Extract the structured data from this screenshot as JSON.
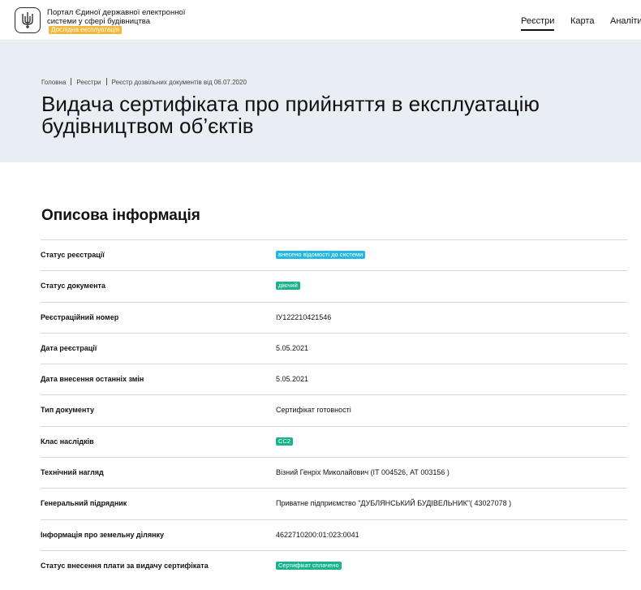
{
  "header": {
    "logo_icon": "trident-coat-of-arms-icon",
    "portal_title": "Портал Єдиної державної електронної системи у сфері будівництва",
    "beta_badge": "Дослідна експлуатація",
    "nav": {
      "registers": "Реєстри",
      "map": "Карта",
      "analytics": "Аналіти"
    }
  },
  "breadcrumb": {
    "home": "Головна",
    "registers": "Реєстри",
    "current": "Реєстр дозвільних документів від 06.07.2020"
  },
  "page_title_line1": "Видача сертифіката про прийняття в експлуатацію",
  "page_title_line2": "будівництвом об’єктів",
  "section_title": "Описова інформація",
  "rows": [
    {
      "label": "Статус реєстрації",
      "value": "внесено відомості до системи",
      "kind": "tag",
      "color": "#22b8e0"
    },
    {
      "label": "Статус документа",
      "value": "діючий",
      "kind": "tag",
      "color": "#19b48c"
    },
    {
      "label": "Реєстраційний номер",
      "value": "ІУ122210421546",
      "kind": "text"
    },
    {
      "label": "Дата реєстрації",
      "value": "5.05.2021",
      "kind": "text"
    },
    {
      "label": "Дата внесення останніх змін",
      "value": "5.05.2021",
      "kind": "text"
    },
    {
      "label": "Тип документу",
      "value": "Сертифікат готовності",
      "kind": "text"
    },
    {
      "label": "Клас наслідків",
      "value": "СС2",
      "kind": "tag",
      "color": "#19b48c"
    },
    {
      "label": "Технічний нагляд",
      "value": "Візний Генріх Миколайович (ІТ 004526, АТ 003156 )",
      "kind": "text"
    },
    {
      "label": "Генеральний підрядник",
      "value": "Приватне підприємство \"ДУБЛЯНСЬКИЙ БУДІВЕЛЬНИК\"( 43027078 )",
      "kind": "text"
    },
    {
      "label": "Інформація про земельну ділянку",
      "value": "4622710200:01:023:0041",
      "kind": "text"
    },
    {
      "label": "Статус внесення плати за видачу сертифіката",
      "value": "Сертифікат сплачено",
      "kind": "tag",
      "color": "#19b48c"
    }
  ]
}
